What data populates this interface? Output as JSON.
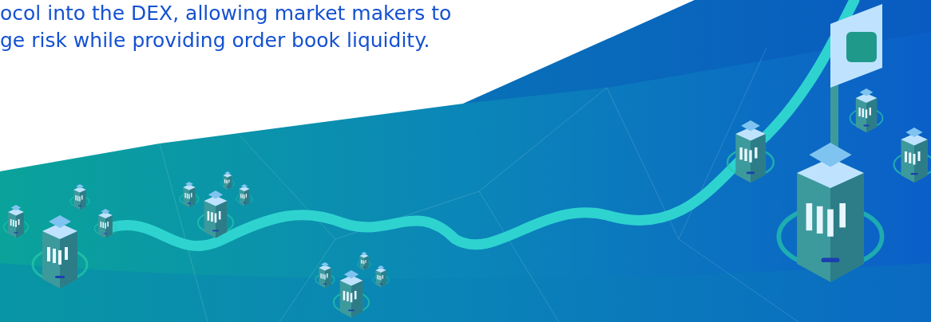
{
  "intro": {
    "text": "ocol into the DEX, allowing market makers to\nge risk while providing order book liquidity."
  }
}
